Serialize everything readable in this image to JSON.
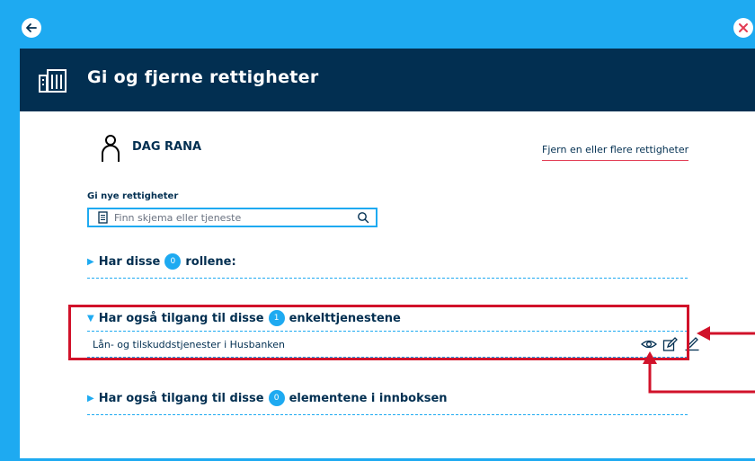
{
  "modal": {
    "title": "Gi og fjerne rettigheter"
  },
  "user": {
    "name": "DAG RANA"
  },
  "remove_link": "Fjern en eller flere rettigheter",
  "new_rights": {
    "label": "Gi nye rettigheter",
    "search_placeholder": "Finn skjema eller tjeneste"
  },
  "sections": {
    "roles": {
      "prefix": "Har disse",
      "count": "0",
      "suffix": "rollene:"
    },
    "services": {
      "prefix": "Har også tilgang til disse",
      "count": "1",
      "suffix": "enkelttjenestene"
    },
    "inbox": {
      "prefix": "Har også tilgang til disse",
      "count": "0",
      "suffix": "elementene i innboksen"
    }
  },
  "service_items": [
    {
      "name": "Lån- og tilskuddstjenester i Husbanken"
    }
  ],
  "colors": {
    "background": "#1eaaf1",
    "header": "#022f51",
    "accent": "#1eaaf1",
    "highlight": "#d1122a"
  },
  "icons": [
    "back-arrow-icon",
    "close-icon",
    "building-icon",
    "user-icon",
    "document-icon",
    "search-icon",
    "eye-icon",
    "edit-icon",
    "pencil-icon"
  ]
}
